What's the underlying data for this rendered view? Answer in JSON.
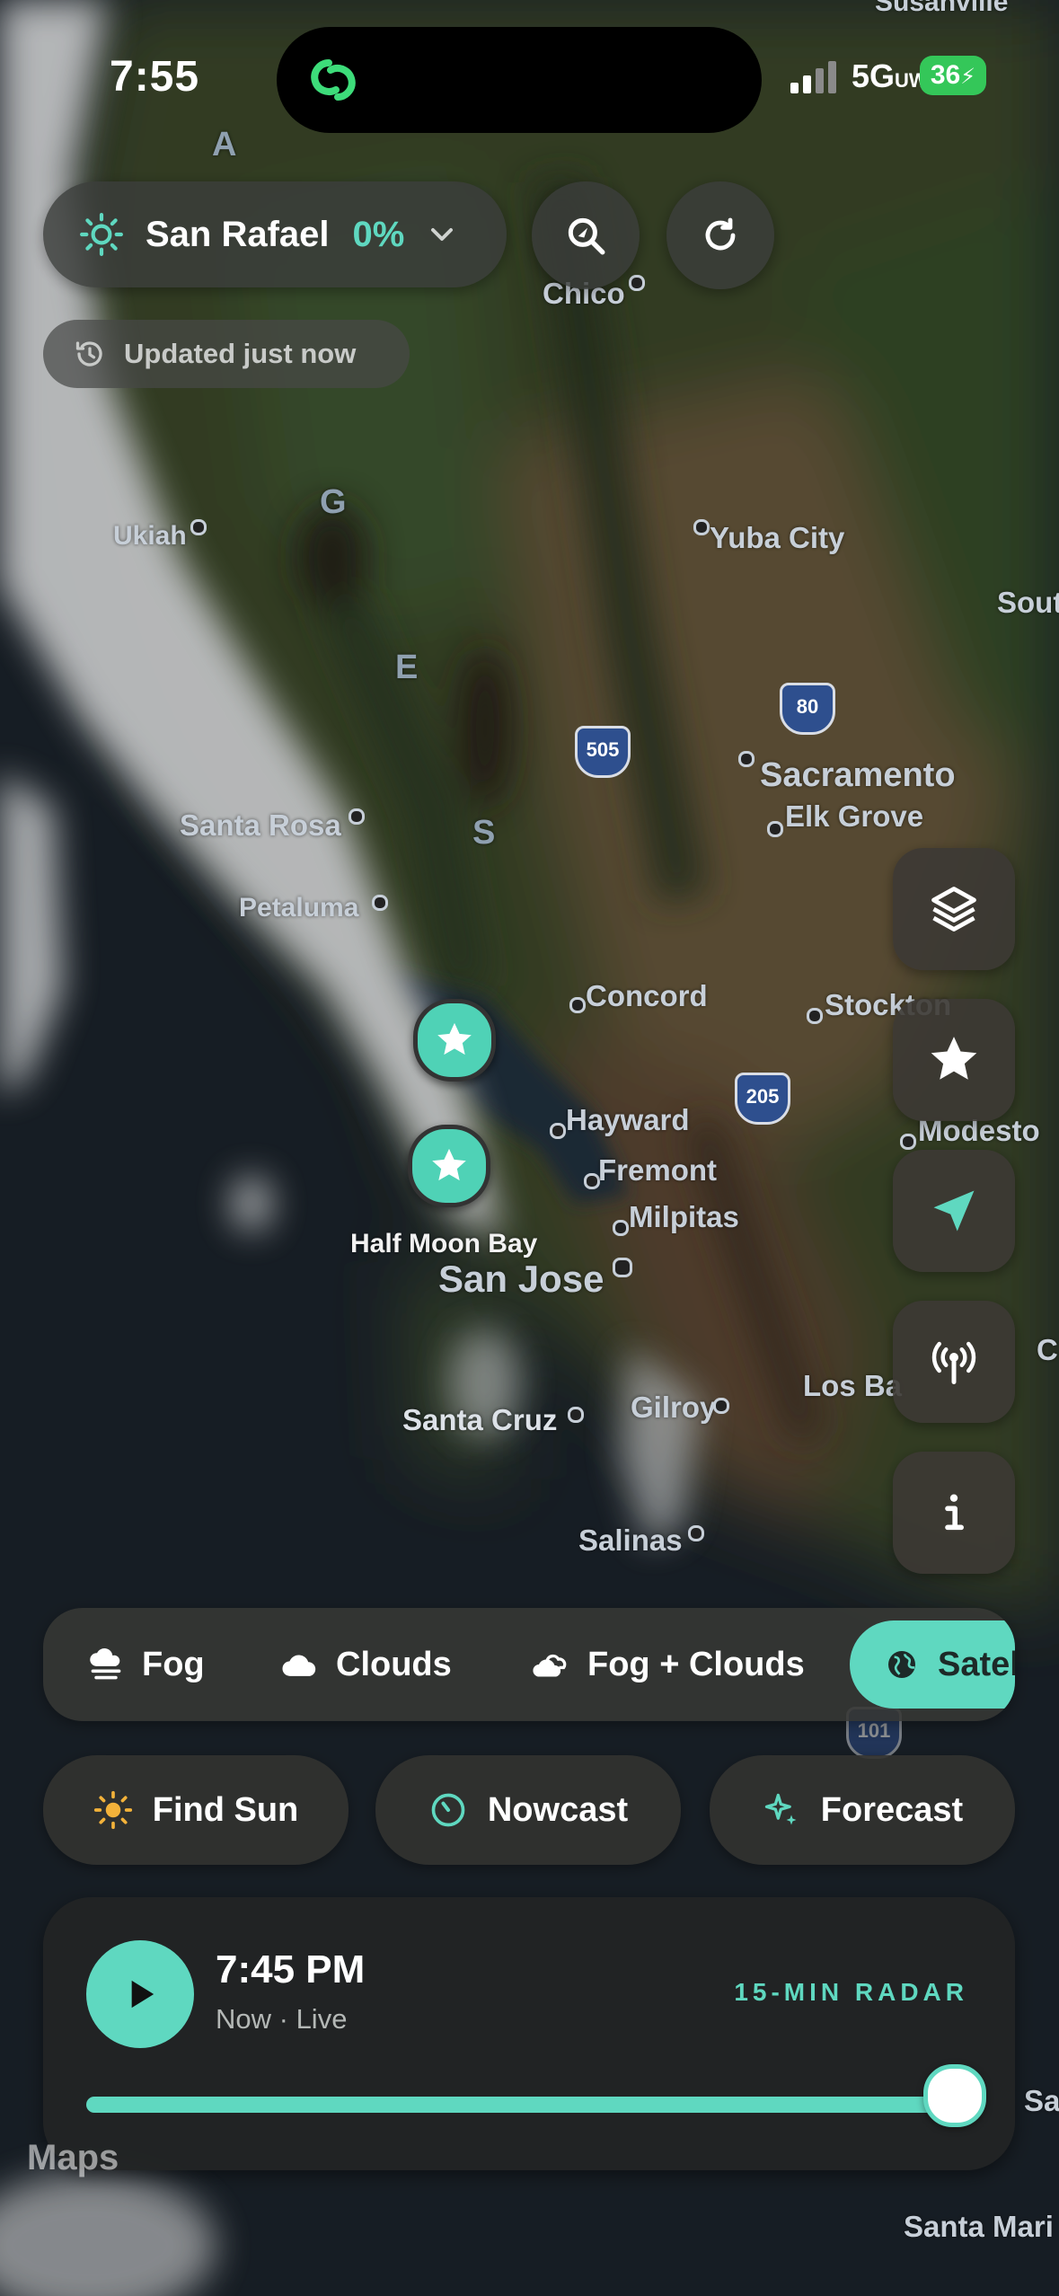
{
  "status_bar": {
    "time": "7:55",
    "network": "5G",
    "network_suffix": "UW",
    "battery": "36"
  },
  "top": {
    "location_name": "San Rafael",
    "location_percent": "0%",
    "updated_text": "Updated just now"
  },
  "map_labels": [
    {
      "id": "susanville",
      "text": "Susanville"
    },
    {
      "id": "chico",
      "text": "Chico"
    },
    {
      "id": "ukiah",
      "text": "Ukiah"
    },
    {
      "id": "yuba-city",
      "text": "Yuba City"
    },
    {
      "id": "south",
      "text": "Sout"
    },
    {
      "id": "sacramento",
      "text": "Sacramento"
    },
    {
      "id": "elk-grove",
      "text": "Elk Grove"
    },
    {
      "id": "santa-rosa",
      "text": "Santa Rosa"
    },
    {
      "id": "petaluma",
      "text": "Petaluma"
    },
    {
      "id": "concord",
      "text": "Concord"
    },
    {
      "id": "stockton",
      "text": "Stockton"
    },
    {
      "id": "hayward",
      "text": "Hayward"
    },
    {
      "id": "modesto",
      "text": "Modesto"
    },
    {
      "id": "fremont",
      "text": "Fremont"
    },
    {
      "id": "milpitas",
      "text": "Milpitas"
    },
    {
      "id": "half-moon-bay",
      "text": "Half Moon Bay"
    },
    {
      "id": "san-jose",
      "text": "San Jose"
    },
    {
      "id": "los-banos",
      "text": "Los Ba"
    },
    {
      "id": "santa-cruz",
      "text": "Santa Cruz"
    },
    {
      "id": "gilroy",
      "text": "Gilroy"
    },
    {
      "id": "salinas",
      "text": "Salinas"
    },
    {
      "id": "santa-maria",
      "text": "Santa Mari"
    },
    {
      "id": "sa-edge",
      "text": "Sa"
    },
    {
      "id": "c-edge",
      "text": "C"
    }
  ],
  "range_letters": [
    "A",
    "G",
    "E",
    "S"
  ],
  "highways": [
    "505",
    "80",
    "205",
    "101"
  ],
  "layer_chips": [
    {
      "label": "Fog",
      "icon": "fog-icon"
    },
    {
      "label": "Clouds",
      "icon": "cloud-icon"
    },
    {
      "label": "Fog + Clouds",
      "icon": "fog-clouds-icon"
    },
    {
      "label": "Satel",
      "icon": "globe-icon",
      "active": true
    }
  ],
  "tools": [
    {
      "label": "Find Sun",
      "icon": "sun-icon"
    },
    {
      "label": "Nowcast",
      "icon": "gauge-icon"
    },
    {
      "label": "Forecast",
      "icon": "sparkle-icon"
    }
  ],
  "player": {
    "time": "7:45 PM",
    "subtitle": "Now · Live",
    "mode": "15-MIN RADAR",
    "progress": 1.0
  },
  "brand": {
    "maps_text": "Maps"
  },
  "colors": {
    "accent": "#5fd8c0",
    "battery": "#34c759"
  }
}
